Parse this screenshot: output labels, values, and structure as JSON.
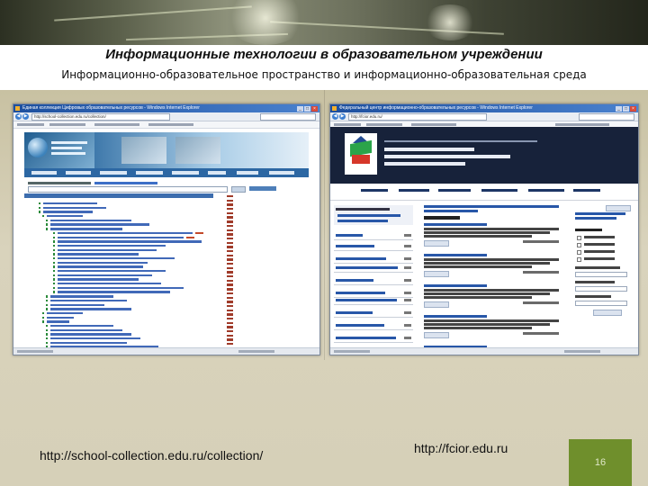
{
  "slide": {
    "title": "Информационные технологии в образовательном учреждении",
    "subtitle": "Информационно-образовательное пространство и информационно-образовательная среда",
    "page_number": "16",
    "colors": {
      "page_number_box": "#6f8f2c",
      "header_band": "#ffffff",
      "background": "#d5cfb7"
    }
  },
  "screenshots": [
    {
      "caption": "http://school-collection.edu.ru/collection/",
      "window_title": "Единая коллекция Цифровых образовательных ресурсов - Windows Internet Explorer",
      "address": "http://school-collection.edu.ru/collection/"
    },
    {
      "caption": "http://fcior.edu.ru",
      "window_title": "Федеральный центр информационно-образовательных ресурсов - Windows Internet Explorer",
      "address": "http://fcior.edu.ru/"
    }
  ]
}
